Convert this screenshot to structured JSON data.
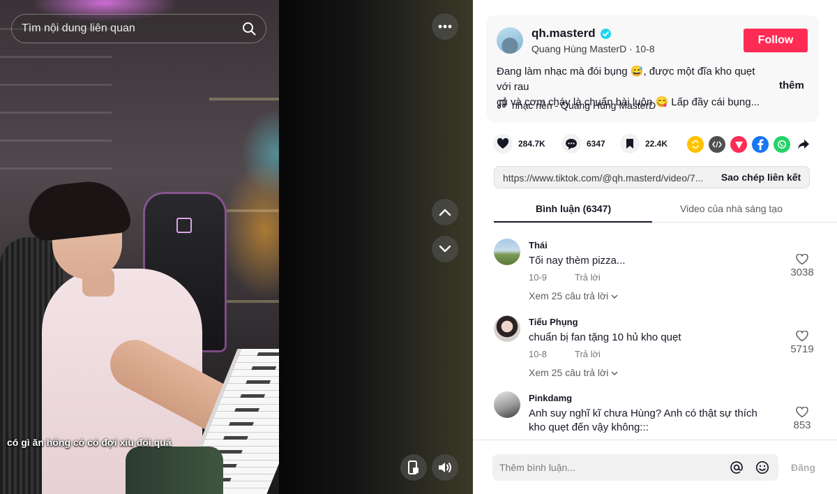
{
  "search": {
    "placeholder": "Tìm nội dung liên quan"
  },
  "video": {
    "caption": "có gì ăn hông có có đợi xíu đói quá"
  },
  "author": {
    "username": "qh.masterd",
    "display_name": "Quang Hùng MasterD",
    "date": "10-8",
    "subline": "Quang Hùng MasterD · 10-8",
    "follow_label": "Follow",
    "description_line1": "Đang làm nhạc mà đói bụng 😅, được một đĩa kho quẹt với rau",
    "description_line2": "củ và cơm cháy là chuẩn bài luôn 😋 Lấp đầy cái bụng...",
    "more_label": "thêm",
    "music": "nhạc nền - Quang Hùng MasterD"
  },
  "stats": {
    "likes": "284.7K",
    "comments": "6347",
    "saves": "22.4K"
  },
  "share_icons": [
    "repost-icon",
    "embed-icon",
    "send-icon",
    "facebook-icon",
    "whatsapp-icon",
    "share-arrow-icon"
  ],
  "colors": {
    "accent": "#fe2c55",
    "verified": "#20d5ec",
    "repost": "#ffc200",
    "embed": "#505050",
    "send": "#fe2c55",
    "facebook": "#1877f2",
    "whatsapp": "#25d366"
  },
  "link": {
    "url": "https://www.tiktok.com/@qh.masterd/video/7...",
    "copy_label": "Sao chép liên kết"
  },
  "tabs": {
    "comments": "Bình luận (6347)",
    "creator_videos": "Video của nhà sáng tạo"
  },
  "comments": [
    {
      "name": "Thái",
      "text": "Tối nay thèm pizza...",
      "date": "10-9",
      "reply": "Trả lời",
      "likes": "3038",
      "view_replies": "Xem 25 câu trả lời"
    },
    {
      "name": "Tiểu Phụng",
      "text": "chuẩn bị fan tặng 10 hủ kho quẹt",
      "date": "10-8",
      "reply": "Trả lời",
      "likes": "5719",
      "view_replies": "Xem 25 câu trả lời"
    },
    {
      "name": "Pinkdamg",
      "text": "Anh suy nghĩ kĩ chưa Hùng? Anh có thật sự thích kho quẹt đến vậy không:::",
      "likes": "853"
    }
  ],
  "composer": {
    "placeholder": "Thêm bình luận...",
    "post_label": "Đăng"
  }
}
